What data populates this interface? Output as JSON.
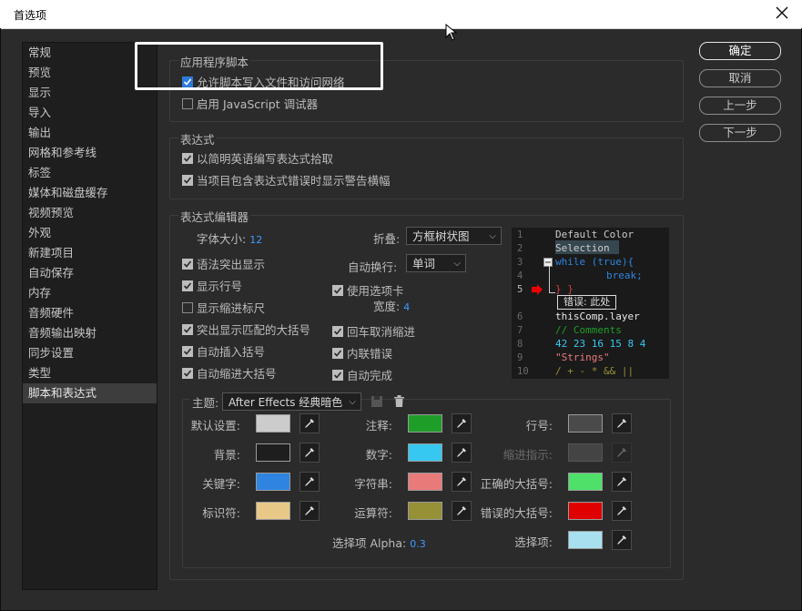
{
  "window": {
    "title": "首选项"
  },
  "sidebar": {
    "items": [
      "常规",
      "预览",
      "显示",
      "导入",
      "输出",
      "网格和参考线",
      "标签",
      "媒体和磁盘缓存",
      "视频预览",
      "外观",
      "新建项目",
      "自动保存",
      "内存",
      "音频硬件",
      "音频输出映射",
      "同步设置",
      "类型",
      "脚本和表达式"
    ],
    "selected_index": 17
  },
  "buttons": {
    "ok": "确定",
    "cancel": "取消",
    "prev": "上一步",
    "next": "下一步"
  },
  "scripts": {
    "title": "应用程序脚本",
    "allow_write": "允许脚本写入文件和访问网络",
    "enable_debugger": "启用 JavaScript 调试器"
  },
  "expressions": {
    "title": "表达式",
    "pick_english": "以简明英语编写表达式拾取",
    "show_warning": "当项目包含表达式错误时显示警告横幅"
  },
  "editor": {
    "title": "表达式编辑器",
    "font_size_label": "字体大小:",
    "font_size": "12",
    "fold_label": "折叠:",
    "fold_value": "方框树状图",
    "wrap_label": "自动换行:",
    "wrap_value": "单词",
    "tabs_label": "使用选项卡",
    "width_label": "宽度:",
    "width_value": "4",
    "syntax": "语法突出显示",
    "line_numbers": "显示行号",
    "indent_guides": "显示缩进标尺",
    "match_brackets": "突出显示匹配的大括号",
    "auto_insert": "自动插入括号",
    "auto_indent": "自动缩进大括号",
    "return_unindent": "回车取消缩进",
    "inline_errors": "内联错误",
    "autocomplete": "自动完成"
  },
  "code_preview": {
    "line_numbers": [
      "1",
      "2",
      "3",
      "4",
      "5",
      "6",
      "7",
      "8",
      "9",
      "10"
    ],
    "lines": [
      "Default Color",
      "Selection",
      "while (true){",
      "break;",
      "} }",
      "thisComp.layer",
      "// Comments",
      "42 23 16 15 8 4",
      "\"Strings\"",
      "/ + - * && ||"
    ],
    "error_text": "错误: 此处"
  },
  "theme": {
    "label": "主题:",
    "value": "After Effects 经典暗色",
    "colors": {
      "default": {
        "label": "默认设置:",
        "color": "#cccccc"
      },
      "background": {
        "label": "背景:",
        "color": "#1e1e1e"
      },
      "keyword": {
        "label": "关键字:",
        "color": "#2e84e0"
      },
      "identifier": {
        "label": "标识符:",
        "color": "#e8c887"
      },
      "comment": {
        "label": "注释:",
        "color": "#1e9e28"
      },
      "number": {
        "label": "数字:",
        "color": "#36c8f0"
      },
      "string": {
        "label": "字符串:",
        "color": "#e87a7a"
      },
      "operator": {
        "label": "运算符:",
        "color": "#969036"
      },
      "line_number": {
        "label": "行号:",
        "color": "#4a4a4a"
      },
      "indent_guide": {
        "label": "缩进指示:",
        "color": "#444444"
      },
      "correct_brace": {
        "label": "正确的大括号:",
        "color": "#4fe06a"
      },
      "wrong_brace": {
        "label": "错误的大括号:",
        "color": "#e00000"
      },
      "selection": {
        "label": "选择项:",
        "color": "#a8e0f0"
      }
    },
    "alpha_label": "选择项 Alpha:",
    "alpha_value": "0.3"
  }
}
